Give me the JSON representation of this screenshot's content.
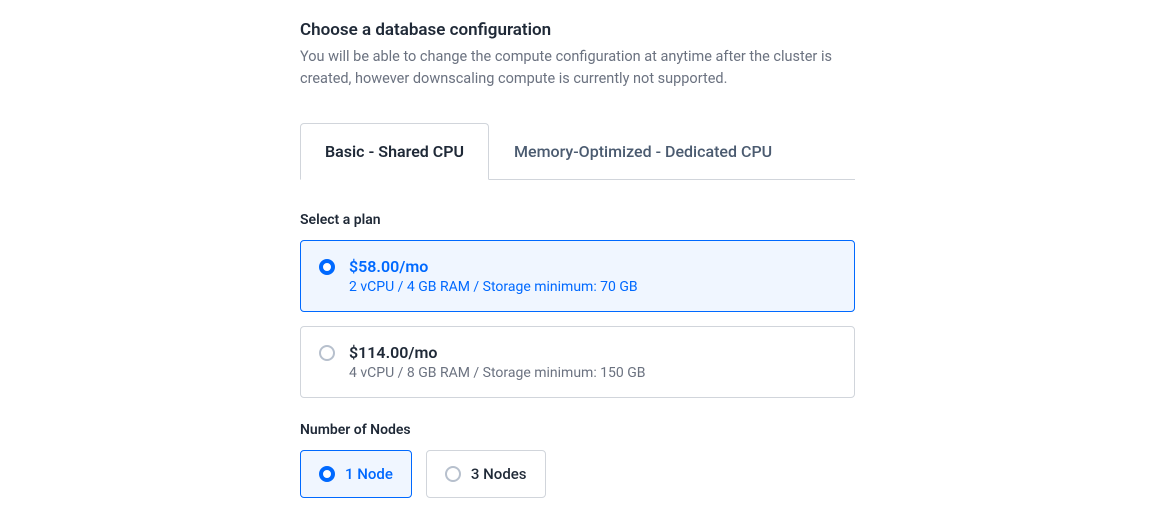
{
  "header": {
    "title": "Choose a database configuration",
    "description": "You will be able to change the compute configuration at anytime after the cluster is created, however downscaling compute is currently not supported."
  },
  "tabs": [
    {
      "label": "Basic - Shared CPU",
      "active": true
    },
    {
      "label": "Memory-Optimized - Dedicated CPU",
      "active": false
    }
  ],
  "plans": {
    "title": "Select a plan",
    "options": [
      {
        "price": "$58.00/mo",
        "specs": "2 vCPU / 4 GB RAM / Storage minimum: 70 GB",
        "selected": true
      },
      {
        "price": "$114.00/mo",
        "specs": "4 vCPU / 8 GB RAM / Storage minimum: 150 GB",
        "selected": false
      }
    ]
  },
  "nodes": {
    "title": "Number of Nodes",
    "options": [
      {
        "label": "1 Node",
        "selected": true
      },
      {
        "label": "3 Nodes",
        "selected": false
      }
    ]
  }
}
